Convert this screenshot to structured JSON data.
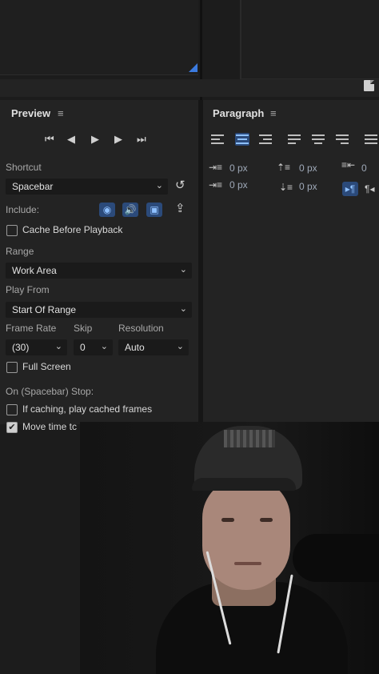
{
  "preview": {
    "title": "Preview",
    "shortcut_label": "Shortcut",
    "shortcut_value": "Spacebar",
    "include_label": "Include:",
    "cache_label": "Cache Before Playback",
    "range_label": "Range",
    "range_value": "Work Area",
    "play_from_label": "Play From",
    "play_from_value": "Start Of Range",
    "frame_rate_label": "Frame Rate",
    "frame_rate_value": "(30)",
    "skip_label": "Skip",
    "skip_value": "0",
    "resolution_label": "Resolution",
    "resolution_value": "Auto",
    "full_screen_label": "Full Screen",
    "stop_label": "On (Spacebar) Stop:",
    "if_caching_label": "If caching, play cached frames",
    "move_time_label": "Move time tc"
  },
  "paragraph": {
    "title": "Paragraph",
    "indent_left": "0 px",
    "space_before": "0 px",
    "indent_right": "0",
    "first_line_indent": "0 px",
    "space_after": "0 px"
  },
  "icons": {
    "menu": "≡",
    "chevron": "⌄",
    "first_frame": "⏮",
    "prev_frame": "◀",
    "play": "▶",
    "next_frame": "▶",
    "last_frame": "⏭",
    "reset": "↺",
    "eye": "◉",
    "audio": "🔊",
    "overlay": "▣",
    "export": "⇪",
    "check": "✔"
  },
  "colors": {
    "accent": "#3b7be0",
    "panel_bg": "#232323"
  }
}
